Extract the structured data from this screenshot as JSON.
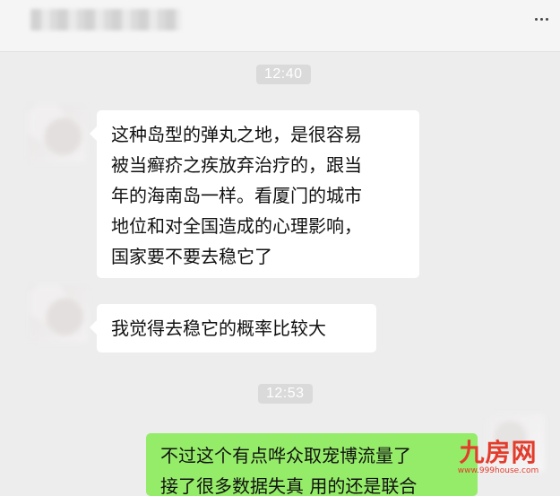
{
  "header": {
    "title_blurred": "",
    "more_icon": "ellipsis-icon"
  },
  "timestamps": {
    "first": "12:40",
    "second": "12:53"
  },
  "messages": [
    {
      "side": "left",
      "lines": [
        "这种岛型的弹丸之地，是很容易",
        "被当癣疥之疾放弃治疗的，跟当",
        "年的海南岛一样。看厦门的城市",
        "地位和对全国造成的心理影响，",
        "国家要不要去稳它了"
      ]
    },
    {
      "side": "left",
      "lines": [
        "我觉得去稳它的概率比较大"
      ]
    },
    {
      "side": "right",
      "lines": [
        "不过这个有点哗众取宠博流量了",
        "接了很多数据失真 用的还是联合"
      ]
    }
  ],
  "watermark": {
    "main": "九房网",
    "sub": "www.999house.com"
  },
  "colors": {
    "background": "#ededed",
    "incoming_bubble": "#ffffff",
    "outgoing_bubble": "#95ec69",
    "timestamp_bg": "#dadada",
    "watermark": "#e23c2c"
  }
}
